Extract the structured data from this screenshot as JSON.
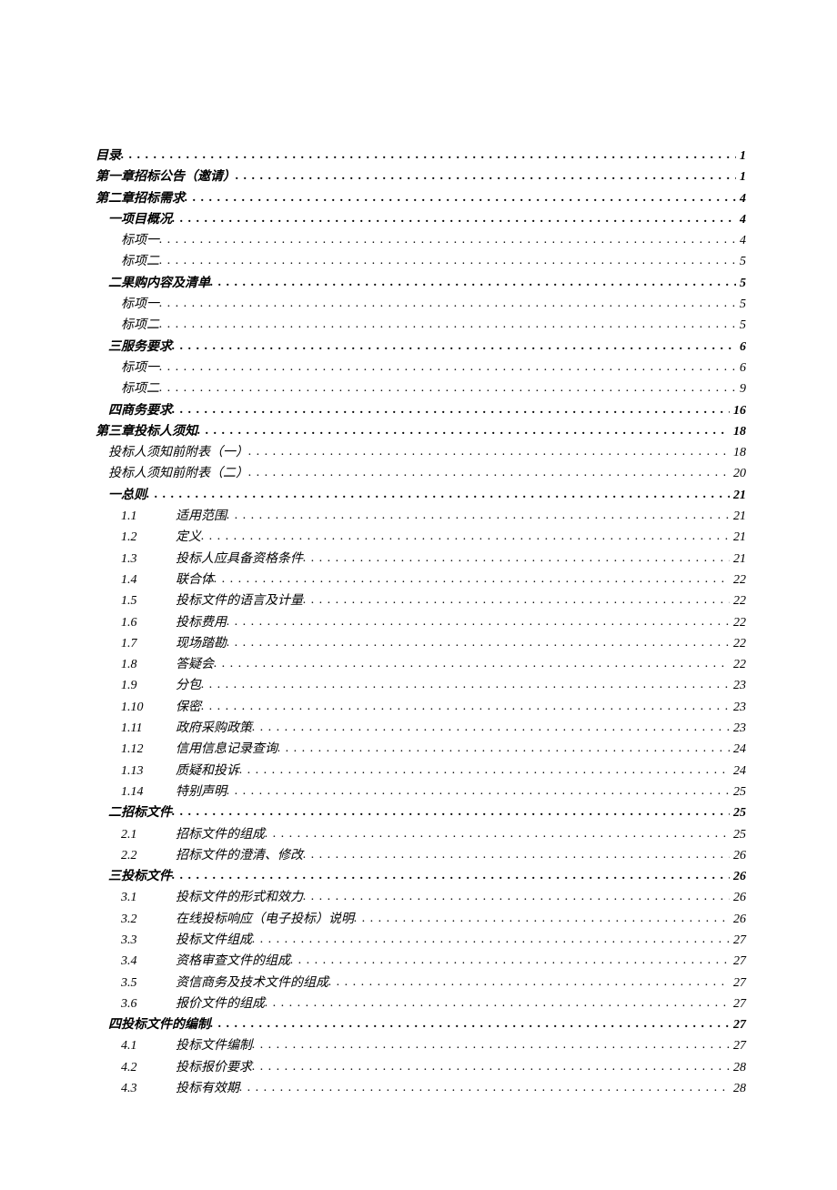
{
  "toc": [
    {
      "indent": 0,
      "num": "",
      "title": "目录",
      "page": "1",
      "bold": true,
      "italic": true
    },
    {
      "indent": 0,
      "num": "",
      "title": "第一章招标公告（邀请）",
      "page": "1",
      "bold": true,
      "italic": true
    },
    {
      "indent": 0,
      "num": "",
      "title": "第二章招标需求",
      "page": "4",
      "bold": true,
      "italic": true
    },
    {
      "indent": 1,
      "num": "",
      "title": "一项目概况",
      "page": "4",
      "bold": true,
      "italic": true
    },
    {
      "indent": 2,
      "num": "",
      "title": "标项一",
      "page": "4",
      "bold": false,
      "italic": true
    },
    {
      "indent": 2,
      "num": "",
      "title": "标项二",
      "page": "5",
      "bold": false,
      "italic": true
    },
    {
      "indent": 1,
      "num": "",
      "title": "二果购内容及清单",
      "page": "5",
      "bold": true,
      "italic": true
    },
    {
      "indent": 2,
      "num": "",
      "title": "标项一",
      "page": "5",
      "bold": false,
      "italic": true
    },
    {
      "indent": 2,
      "num": "",
      "title": "标项二",
      "page": "5",
      "bold": false,
      "italic": true
    },
    {
      "indent": 1,
      "num": "",
      "title": "三服务要求",
      "page": "6",
      "bold": true,
      "italic": true
    },
    {
      "indent": 2,
      "num": "",
      "title": "标项一",
      "page": "6",
      "bold": false,
      "italic": true
    },
    {
      "indent": 2,
      "num": "",
      "title": "标项二",
      "page": "9",
      "bold": false,
      "italic": true
    },
    {
      "indent": 1,
      "num": "",
      "title": "四商务要求",
      "page": "16",
      "bold": true,
      "italic": true
    },
    {
      "indent": 0,
      "num": "",
      "title": "第三章投标人须知",
      "page": "18",
      "bold": true,
      "italic": true
    },
    {
      "indent": 1,
      "num": "",
      "title": "投标人须知前附表（一）",
      "page": "18",
      "bold": false,
      "italic": true
    },
    {
      "indent": 1,
      "num": "",
      "title": "投标人须知前附表（二）",
      "page": "20",
      "bold": false,
      "italic": true
    },
    {
      "indent": 1,
      "num": "",
      "title": "一总则",
      "page": "21",
      "bold": true,
      "italic": true
    },
    {
      "indent": 3,
      "num": "1.1",
      "title": "适用范围",
      "page": "21",
      "bold": false,
      "italic": true
    },
    {
      "indent": 3,
      "num": "1.2",
      "title": "定义",
      "page": "21",
      "bold": false,
      "italic": true
    },
    {
      "indent": 3,
      "num": "1.3",
      "title": "投标人应具备资格条件",
      "page": "21",
      "bold": false,
      "italic": true
    },
    {
      "indent": 3,
      "num": "1.4",
      "title": "联合体",
      "page": "22",
      "bold": false,
      "italic": true
    },
    {
      "indent": 3,
      "num": "1.5",
      "title": "投标文件的语言及计量",
      "page": "22",
      "bold": false,
      "italic": true
    },
    {
      "indent": 3,
      "num": "1.6",
      "title": "投标费用",
      "page": "22",
      "bold": false,
      "italic": true
    },
    {
      "indent": 3,
      "num": "1.7",
      "title": "现场踏勘",
      "page": "22",
      "bold": false,
      "italic": true
    },
    {
      "indent": 3,
      "num": "1.8",
      "title": "答疑会",
      "page": "22",
      "bold": false,
      "italic": true
    },
    {
      "indent": 3,
      "num": "1.9",
      "title": "分包",
      "page": "23",
      "bold": false,
      "italic": true
    },
    {
      "indent": 3,
      "num": "1.10",
      "title": "保密",
      "page": "23",
      "bold": false,
      "italic": true
    },
    {
      "indent": 3,
      "num": "1.11",
      "title": "政府采购政策",
      "page": "23",
      "bold": false,
      "italic": true
    },
    {
      "indent": 3,
      "num": "1.12",
      "title": "信用信息记录查询",
      "page": "24",
      "bold": false,
      "italic": true
    },
    {
      "indent": 3,
      "num": "1.13",
      "title": "质疑和投诉",
      "page": "24",
      "bold": false,
      "italic": true
    },
    {
      "indent": 3,
      "num": "1.14",
      "title": "特别声明",
      "page": "25",
      "bold": false,
      "italic": true
    },
    {
      "indent": 1,
      "num": "",
      "title": "二招标文件",
      "page": "25",
      "bold": true,
      "italic": true
    },
    {
      "indent": 3,
      "num": "2.1",
      "title": "招标文件的组成",
      "page": "25",
      "bold": false,
      "italic": true
    },
    {
      "indent": 3,
      "num": "2.2",
      "title": "招标文件的澄清、修改",
      "page": "26",
      "bold": false,
      "italic": true
    },
    {
      "indent": 1,
      "num": "",
      "title": "三投标文件",
      "page": "26",
      "bold": true,
      "italic": true
    },
    {
      "indent": 3,
      "num": "3.1",
      "title": "投标文件的形式和效力",
      "page": "26",
      "bold": false,
      "italic": true
    },
    {
      "indent": 3,
      "num": "3.2",
      "title": "在线投标响应（电子投标）说明",
      "page": "26",
      "bold": false,
      "italic": true
    },
    {
      "indent": 3,
      "num": "3.3",
      "title": "投标文件组成",
      "page": "27",
      "bold": false,
      "italic": true
    },
    {
      "indent": 3,
      "num": "3.4",
      "title": "资格审查文件的组成",
      "page": "27",
      "bold": false,
      "italic": true
    },
    {
      "indent": 3,
      "num": "3.5",
      "title": "资信商务及技术文件的组成",
      "page": "27",
      "bold": false,
      "italic": true
    },
    {
      "indent": 3,
      "num": "3.6",
      "title": "报价文件的组成",
      "page": "27",
      "bold": false,
      "italic": true
    },
    {
      "indent": 1,
      "num": "",
      "title": "四投标文件的编制",
      "page": "27",
      "bold": true,
      "italic": true
    },
    {
      "indent": 3,
      "num": "4.1",
      "title": "投标文件编制",
      "page": "27",
      "bold": false,
      "italic": true
    },
    {
      "indent": 3,
      "num": "4.2",
      "title": "投标报价要求",
      "page": "28",
      "bold": false,
      "italic": true
    },
    {
      "indent": 3,
      "num": "4.3",
      "title": "投标有效期",
      "page": "28",
      "bold": false,
      "italic": true
    }
  ]
}
